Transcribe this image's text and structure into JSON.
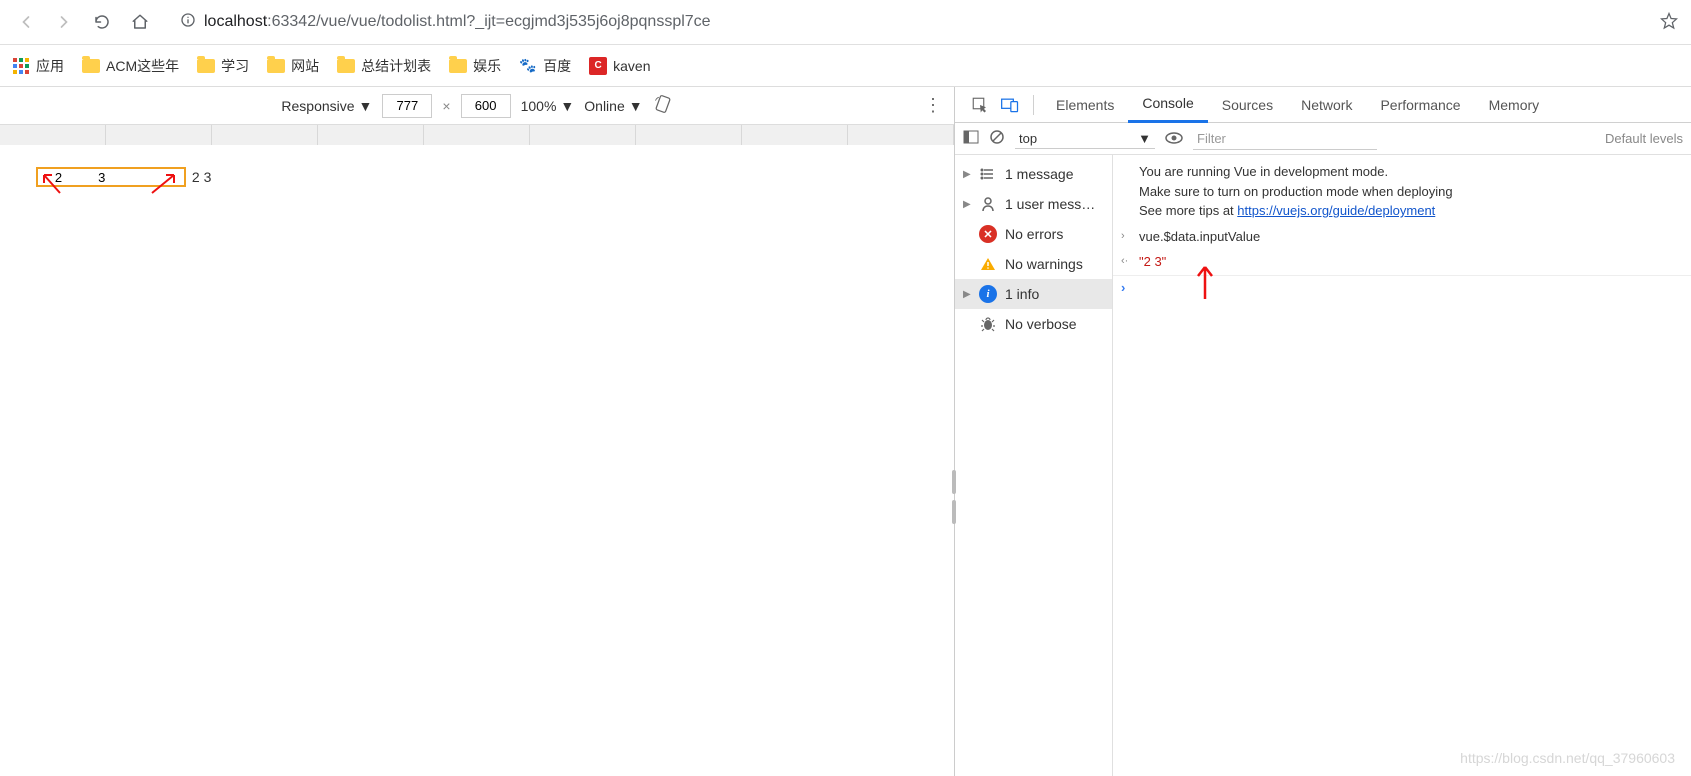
{
  "browser": {
    "url_host": "localhost",
    "url_port": ":63342",
    "url_path": "/vue/vue/todolist.html?_ijt=ecgjmd3j535j6oj8pqnsspl7ce"
  },
  "bookmarks": {
    "apps": "应用",
    "items": [
      "ACM这些年",
      "学习",
      "网站",
      "总结计划表",
      "娱乐"
    ],
    "baidu": "百度",
    "kaven": "kaven"
  },
  "device_toolbar": {
    "mode": "Responsive",
    "width": "777",
    "height": "600",
    "zoom": "100%",
    "network": "Online"
  },
  "viewport": {
    "input_value": "   2          3",
    "text_after": "2 3"
  },
  "devtools": {
    "tabs": [
      "Elements",
      "Console",
      "Sources",
      "Network",
      "Performance",
      "Memory"
    ],
    "active_tab": "Console",
    "context": "top",
    "filter_placeholder": "Filter",
    "default_levels": "Default levels",
    "sidebar": {
      "messages": "1 message",
      "user_messages": "1 user mess…",
      "no_errors": "No errors",
      "no_warnings": "No warnings",
      "info": "1 info",
      "no_verbose": "No verbose"
    },
    "log": {
      "vue_dev_line1": "You are running Vue in development mode.",
      "vue_dev_line2": "Make sure to turn on production mode when deploying",
      "vue_dev_line3_prefix": "See more tips at ",
      "vue_dev_link": "https://vuejs.org/guide/deployment",
      "command": "vue.$data.inputValue",
      "result": "\"2          3\""
    }
  },
  "watermark": "https://blog.csdn.net/qq_37960603"
}
